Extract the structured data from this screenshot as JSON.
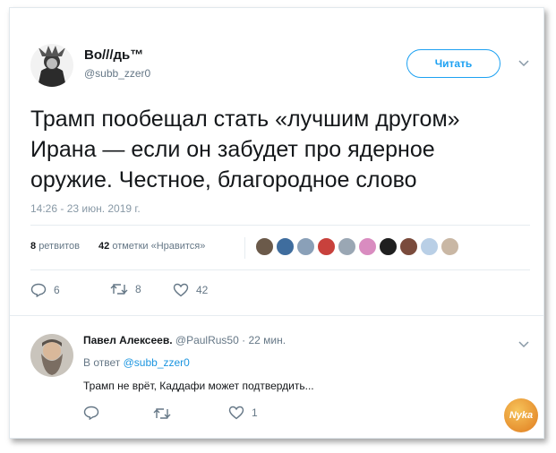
{
  "author": {
    "name": "Во///дь™",
    "handle": "@subb_zzer0"
  },
  "follow_label": "Читать",
  "tweet": {
    "lines": [
      "Трамп пообещал стать «лучшим другом»",
      "Ирана — если он забудет про ядерное",
      "оружие. Честное, благородное слово"
    ],
    "timestamp": "14:26 - 23 июн. 2019 г."
  },
  "stats": {
    "retweets_count": "8",
    "retweets_label": "ретвитов",
    "likes_count": "42",
    "likes_label": "отметки «Нравится»"
  },
  "liker_avatars": [
    "#6b5a4a",
    "#3f6d9e",
    "#8aa0b8",
    "#c8413c",
    "#9aa7b4",
    "#d98cc0",
    "#1f1f1f",
    "#7a4b3c",
    "#b9cfe6",
    "#c9b7a4"
  ],
  "actions": {
    "replies": "6",
    "retweets": "8",
    "likes": "42"
  },
  "reply": {
    "name": "Павел Алексеев.",
    "handle": "@PaulRus50",
    "separator": "·",
    "time": "22 мин.",
    "in_reply_prefix": "В ответ",
    "in_reply_handle": "@subb_zzer0",
    "text": "Трамп не врёт, Каддафи может подтвердить...",
    "likes": "1"
  },
  "watermark": "Nyka"
}
